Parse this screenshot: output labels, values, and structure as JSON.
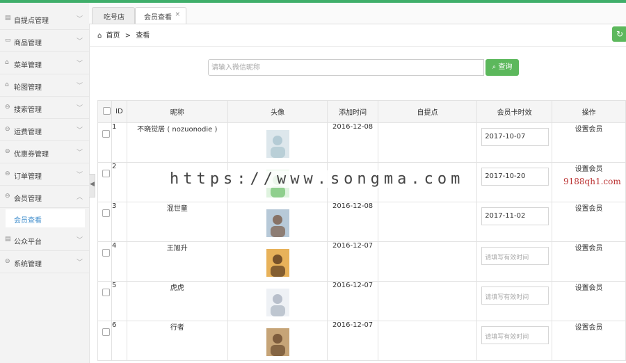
{
  "sidebar": {
    "items": [
      {
        "label": "自提点管理",
        "icon": "doc-icon"
      },
      {
        "label": "商品管理",
        "icon": "box-icon"
      },
      {
        "label": "菜单管理",
        "icon": "lock-icon"
      },
      {
        "label": "轮图管理",
        "icon": "lock-icon"
      },
      {
        "label": "搜索管理",
        "icon": "circle-icon"
      },
      {
        "label": "运费管理",
        "icon": "circle-icon"
      },
      {
        "label": "优惠券管理",
        "icon": "circle-icon"
      },
      {
        "label": "订单管理",
        "icon": "circle-icon"
      },
      {
        "label": "会员管理",
        "icon": "circle-icon",
        "expanded": true
      },
      {
        "label": "公众平台",
        "icon": "doc-icon"
      },
      {
        "label": "系统管理",
        "icon": "circle-icon"
      }
    ],
    "sub_item": "会员查看"
  },
  "tabs": [
    {
      "label": "吃号店"
    },
    {
      "label": "会员查看",
      "close": "×",
      "active": true
    }
  ],
  "breadcrumb": {
    "home": "首页",
    "separator": ">",
    "current": "查看"
  },
  "search": {
    "placeholder": "请输入微信昵称",
    "button": "查询"
  },
  "table": {
    "headers": [
      "ID",
      "昵称",
      "头像",
      "添加时间",
      "自提点",
      "会员卡时效",
      "操作"
    ],
    "rows": [
      {
        "id": "1",
        "nickname": "不晓觉居 ( nozuonodie )",
        "date": "2016-12-08",
        "pickup": "",
        "card": "2017-10-07",
        "action": "设置会员",
        "avatar_colors": [
          "#dde7ec",
          "#aac4cf"
        ]
      },
      {
        "id": "2",
        "nickname": "",
        "date": "",
        "pickup": "",
        "card": "2017-10-20",
        "action": "设置会员",
        "avatar_colors": [
          "#dff3df",
          "#6cbf6a"
        ]
      },
      {
        "id": "3",
        "nickname": "混世童",
        "date": "2016-12-08",
        "pickup": "",
        "card": "2017-11-02",
        "action": "设置会员",
        "avatar_colors": [
          "#b7c9d8",
          "#7a5c4a"
        ]
      },
      {
        "id": "4",
        "nickname": "王旭升",
        "date": "2016-12-07",
        "pickup": "",
        "card": "",
        "action": "设置会员",
        "avatar_colors": [
          "#e8b25a",
          "#5a3a1e"
        ]
      },
      {
        "id": "5",
        "nickname": "虎虎",
        "date": "2016-12-07",
        "pickup": "",
        "card": "",
        "action": "设置会员",
        "avatar_colors": [
          "#eef1f5",
          "#aab3c0"
        ]
      },
      {
        "id": "6",
        "nickname": "行者",
        "date": "2016-12-07",
        "pickup": "",
        "card": "",
        "action": "设置会员",
        "avatar_colors": [
          "#c6a477",
          "#6a4a2e"
        ]
      }
    ],
    "card_placeholder": "请填写有效时间"
  },
  "watermark": {
    "main": "https://www.songma.com",
    "side": "9188qh1.com"
  },
  "colors": {
    "accent": "#5cb85c",
    "topline": "#3fae6a",
    "link": "#3f8dcc"
  }
}
